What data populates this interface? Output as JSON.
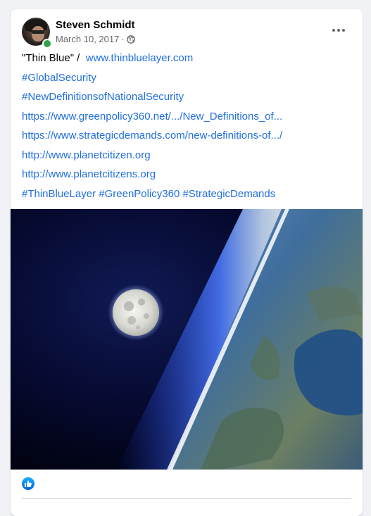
{
  "post": {
    "author": "Steven Schmidt",
    "date": "March 10, 2017",
    "separator": "·",
    "audience_icon": "globe-icon",
    "lines": {
      "title_text": "\"Thin Blue\" /",
      "title_link": "www.thinbluelayer.com",
      "hashtag1": "#GlobalSecurity",
      "hashtag2": "#NewDefinitionsofNationalSecurity",
      "url1": "https://www.greenpolicy360.net/.../New_Definitions_of...",
      "url2": "https://www.strategicdemands.com/new-definitions-of.../",
      "url3": "http://www.planetcitizen.org",
      "url4": "http://www.planetcitizens.org",
      "tags": [
        "#ThinBlueLayer",
        "#GreenPolicy360",
        "#StrategicDemands"
      ]
    },
    "photo": {
      "subject": "moon-over-earth-horizon"
    },
    "reaction_icon": "like-icon"
  },
  "colors": {
    "link": "#216fdb",
    "name": "#050505",
    "meta": "#65676b",
    "online": "#31a24c",
    "background": "#f0f2f5"
  }
}
